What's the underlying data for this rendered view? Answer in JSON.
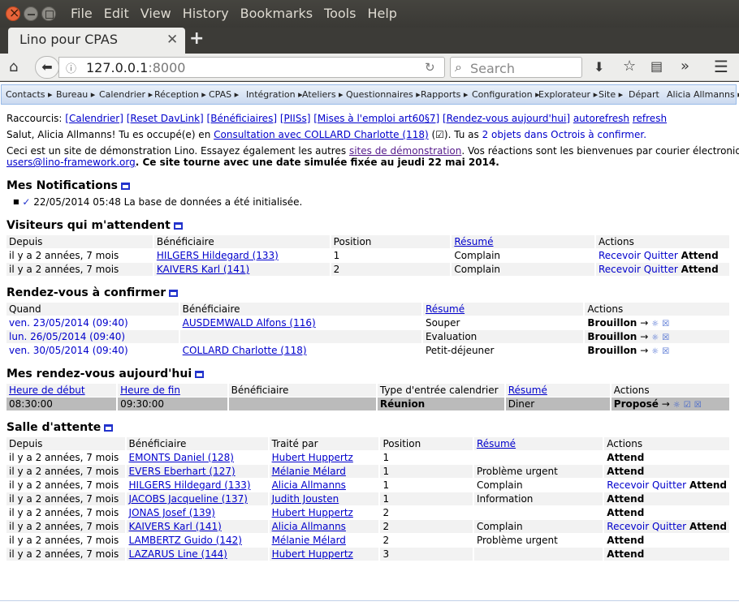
{
  "browser": {
    "menu": [
      "File",
      "Edit",
      "View",
      "History",
      "Bookmarks",
      "Tools",
      "Help"
    ],
    "tab_title": "Lino pour CPAS",
    "url_host": "127.0.0.1",
    "url_port": ":8000",
    "search_placeholder": "Search"
  },
  "toolbar": {
    "items": [
      "Contacts ▸",
      "Bureau ▸",
      "Calendrier ▸",
      "Réception ▸",
      "CPAS ▸",
      "Intégration ▸",
      "Ateliers ▸",
      "Questionnaires ▸",
      "Rapports ▸",
      "Configuration ▸",
      "Explorateur ▸",
      "Site ▸",
      "Départ"
    ],
    "user": "Alicia Allmanns ▸"
  },
  "header": {
    "shortcuts_label": "Raccourcis:",
    "shortcuts": [
      "[Calendrier]",
      "[Reset DavLink]",
      "[Bénéficiaires]",
      "[PIISs]",
      "[Mises à l'emploi art60§7]",
      "[Rendez-vous aujourd'hui]"
    ],
    "autorefresh": "autorefresh",
    "refresh": "refresh",
    "greeting_pre": "Salut, Alicia Allmanns! Tu es occupé(e) en",
    "greeting_link": "Consultation avec COLLARD Charlotte (118)",
    "greeting_mid": "(☑). Tu as",
    "greeting_link2": "2 objets dans Octrois à confirmer.",
    "demo_pre": "Ceci est un site de démonstration Lino. Essayez également les autres",
    "demo_link": "sites de démonstration",
    "demo_post": ". Vos réactions sont les bienvenues par courier électronique à",
    "demo_email": "users@lino-framework.org",
    "demo_bold": ". Ce site tourne avec une date simulée fixée au jeudi 22 mai 2014."
  },
  "notifications": {
    "title": "Mes Notifications",
    "items": [
      {
        "check": "✓",
        "text": "22/05/2014 05:48 La base de données a été initialisée."
      }
    ]
  },
  "visitors": {
    "title": "Visiteurs qui m'attendent",
    "headers": [
      "Depuis",
      "Bénéficiaire",
      "Position",
      "Résumé",
      "Actions"
    ],
    "rows": [
      {
        "since": "il y a 2 années, 7 mois",
        "client": "HILGERS Hildegard (133)",
        "pos": "1",
        "summary": "Complain",
        "a1": "Recevoir",
        "a2": "Quitter",
        "a3": "Attend"
      },
      {
        "since": "il y a 2 années, 7 mois",
        "client": "KAIVERS Karl (141)",
        "pos": "2",
        "summary": "Complain",
        "a1": "Recevoir",
        "a2": "Quitter",
        "a3": "Attend"
      }
    ]
  },
  "appointments": {
    "title": "Rendez-vous à confirmer",
    "headers": [
      "Quand",
      "Bénéficiaire",
      "Résumé",
      "Actions"
    ],
    "rows": [
      {
        "when": "ven. 23/05/2014 (09:40)",
        "client": "AUSDEMWALD Alfons (116)",
        "summary": "Souper",
        "state": "Brouillon",
        "arrow": "→"
      },
      {
        "when": "lun. 26/05/2014 (09:40)",
        "client": "",
        "summary": "Evaluation",
        "state": "Brouillon",
        "arrow": "→"
      },
      {
        "when": "ven. 30/05/2014 (09:40)",
        "client": "COLLARD Charlotte (118)",
        "summary": "Petit-déjeuner",
        "state": "Brouillon",
        "arrow": "→"
      }
    ]
  },
  "today": {
    "title": "Mes rendez-vous aujourd'hui",
    "headers": [
      "Heure de début",
      "Heure de fin",
      "Bénéficiaire",
      "Type d'entrée calendrier",
      "Résumé",
      "Actions"
    ],
    "rows": [
      {
        "start": "08:30:00",
        "end": "09:30:00",
        "client": "",
        "type": "Réunion",
        "summary": "Diner",
        "state": "Proposé",
        "arrow": "→"
      }
    ]
  },
  "waiting": {
    "title": "Salle d'attente",
    "headers": [
      "Depuis",
      "Bénéficiaire",
      "Traité par",
      "Position",
      "Résumé",
      "Actions"
    ],
    "rows": [
      {
        "since": "il y a 2 années, 7 mois",
        "client": "EMONTS Daniel (128)",
        "user": "Hubert Huppertz",
        "pos": "1",
        "summary": "",
        "a1": "",
        "a2": "",
        "a3": "Attend"
      },
      {
        "since": "il y a 2 années, 7 mois",
        "client": "EVERS Eberhart (127)",
        "user": "Mélanie Mélard",
        "pos": "1",
        "summary": "Problème urgent",
        "a1": "",
        "a2": "",
        "a3": "Attend"
      },
      {
        "since": "il y a 2 années, 7 mois",
        "client": "HILGERS Hildegard (133)",
        "user": "Alicia Allmanns",
        "pos": "1",
        "summary": "Complain",
        "a1": "Recevoir",
        "a2": "Quitter",
        "a3": "Attend"
      },
      {
        "since": "il y a 2 années, 7 mois",
        "client": "JACOBS Jacqueline (137)",
        "user": "Judith Jousten",
        "pos": "1",
        "summary": "Information",
        "a1": "",
        "a2": "",
        "a3": "Attend"
      },
      {
        "since": "il y a 2 années, 7 mois",
        "client": "JONAS Josef (139)",
        "user": "Hubert Huppertz",
        "pos": "2",
        "summary": "",
        "a1": "",
        "a2": "",
        "a3": "Attend"
      },
      {
        "since": "il y a 2 années, 7 mois",
        "client": "KAIVERS Karl (141)",
        "user": "Alicia Allmanns",
        "pos": "2",
        "summary": "Complain",
        "a1": "Recevoir",
        "a2": "Quitter",
        "a3": "Attend"
      },
      {
        "since": "il y a 2 années, 7 mois",
        "client": "LAMBERTZ Guido (142)",
        "user": "Mélanie Mélard",
        "pos": "2",
        "summary": "Problème urgent",
        "a1": "",
        "a2": "",
        "a3": "Attend"
      },
      {
        "since": "il y a 2 années, 7 mois",
        "client": "LAZARUS Line (144)",
        "user": "Hubert Huppertz",
        "pos": "3",
        "summary": "",
        "a1": "",
        "a2": "",
        "a3": "Attend"
      }
    ]
  }
}
